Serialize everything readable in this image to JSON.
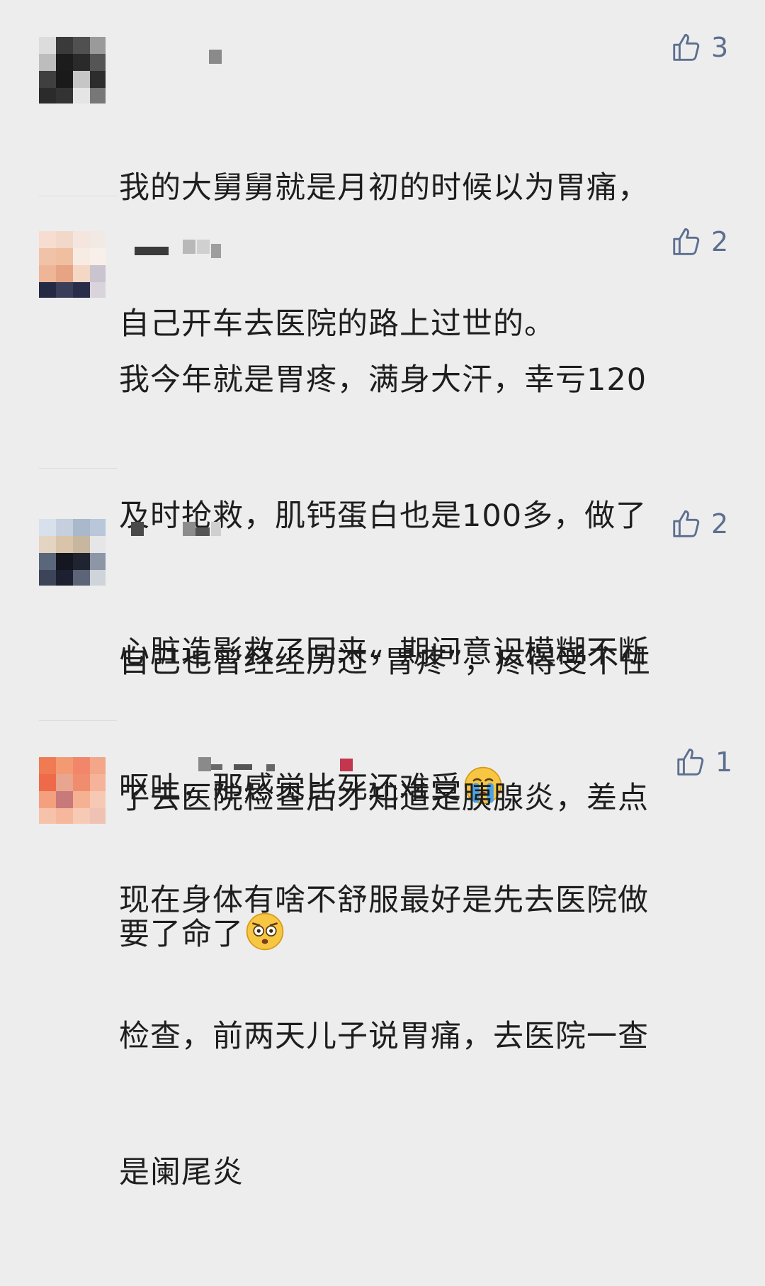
{
  "comments": [
    {
      "likes": "3",
      "lines": [
        "我的大舅舅就是月初的时候以为胃痛，",
        "自己开车去医院的路上过世的。"
      ],
      "emoji": ""
    },
    {
      "likes": "2",
      "lines": [
        "我今年就是胃疼，满身大汗，幸亏120",
        "及时抢救，肌钙蛋白也是100多，做了",
        "心脏造影救了回来，期间意识模糊不断",
        "呕吐，那感觉比死还难受"
      ],
      "emoji": "crying-face-icon"
    },
    {
      "likes": "2",
      "lines": [
        "自己也曾经经历过“胃疼”，疼得受不住",
        "了去医院检查后才知道是胰腺炎，差点",
        "要了命了"
      ],
      "emoji": "flushed-face-icon"
    },
    {
      "likes": "1",
      "lines": [
        "现在身体有啥不舒服最好是先去医院做",
        "检查，前两天儿子说胃痛，去医院一查",
        "是阑尾炎"
      ],
      "emoji": ""
    }
  ],
  "icons": {
    "like": "thumbs-up-outline-icon"
  },
  "colors": {
    "background": "#ededed",
    "text": "#1e1e1e",
    "like": "#5c6f8f"
  }
}
